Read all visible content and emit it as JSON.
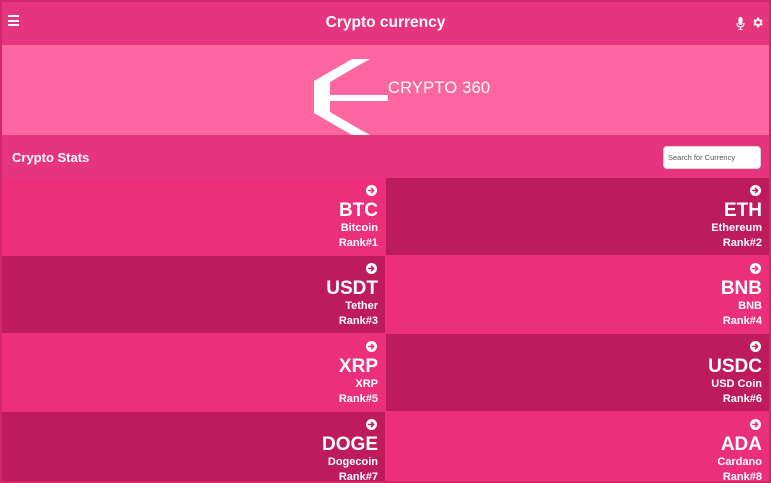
{
  "header": {
    "title": "Crypto currency",
    "menu_icon": "hamburger-menu-icon",
    "mic_icon": "microphone-icon",
    "settings_icon": "gear-icon"
  },
  "banner": {
    "logo_text": "CRYPTO 360"
  },
  "stats": {
    "title": "Crypto Stats",
    "search_placeholder": "Search for Currency"
  },
  "colors": {
    "header": "#e6347e",
    "banner": "#fd669f",
    "card_light": "#ec2f7a",
    "card_dark": "#be1b5d",
    "text": "#ffffff"
  },
  "coins": [
    {
      "symbol": "BTC",
      "name": "Bitcoin",
      "rank": "Rank#1"
    },
    {
      "symbol": "ETH",
      "name": "Ethereum",
      "rank": "Rank#2"
    },
    {
      "symbol": "USDT",
      "name": "Tether",
      "rank": "Rank#3"
    },
    {
      "symbol": "BNB",
      "name": "BNB",
      "rank": "Rank#4"
    },
    {
      "symbol": "XRP",
      "name": "XRP",
      "rank": "Rank#5"
    },
    {
      "symbol": "USDC",
      "name": "USD Coin",
      "rank": "Rank#6"
    },
    {
      "symbol": "DOGE",
      "name": "Dogecoin",
      "rank": "Rank#7"
    },
    {
      "symbol": "ADA",
      "name": "Cardano",
      "rank": "Rank#8"
    }
  ]
}
